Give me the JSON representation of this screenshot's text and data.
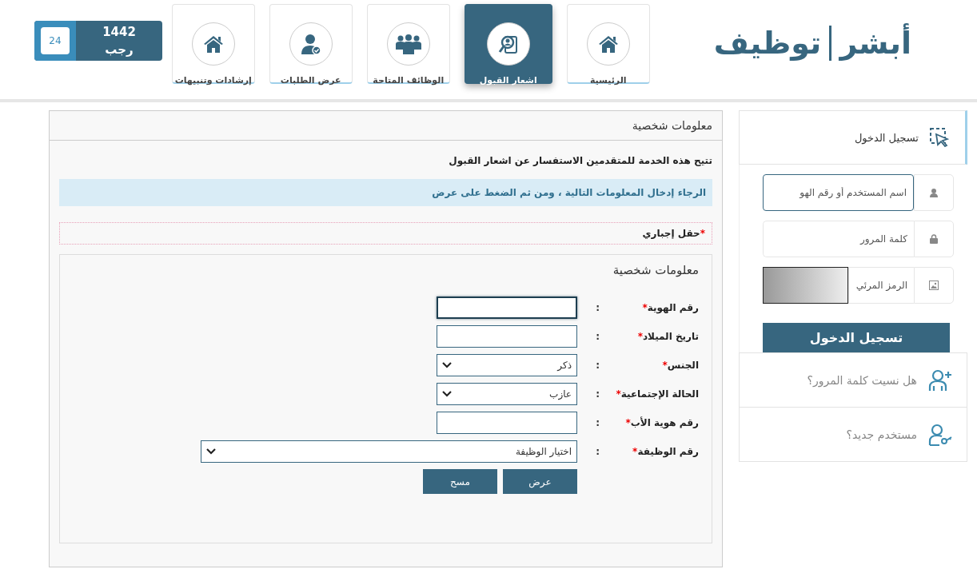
{
  "logo": {
    "word_1": "أبشر",
    "word_2": "توظيف"
  },
  "nav_tabs": [
    {
      "label": "الرئيسية",
      "kind": "home",
      "selected": false
    },
    {
      "label": "اشعار القبول",
      "kind": "acceptance",
      "selected": true
    },
    {
      "label": "الوظائف المتاحة",
      "kind": "jobs",
      "selected": false
    },
    {
      "label": "عرض الطلبات",
      "kind": "requests",
      "selected": false
    },
    {
      "label": "إرشادات وتنبيهات",
      "kind": "guidance",
      "selected": false
    }
  ],
  "date_badge": {
    "year": "1442",
    "month": "رجب",
    "day": "24"
  },
  "sidebar": {
    "login_title": "تسجيل الدخول",
    "username": {
      "placeholder": "اسم المستخدم أو رقم الهو",
      "focused": true
    },
    "password": {
      "placeholder": "كلمة المرور"
    },
    "captcha": {
      "placeholder": "الرمز المرئي"
    },
    "login_button": "تسجيل الدخول",
    "links": [
      {
        "label": "هل نسيت كلمة المرور؟",
        "kind": "forgot"
      },
      {
        "label": "مستخدم جديد؟",
        "kind": "new_user"
      }
    ]
  },
  "panel": {
    "title": "معلومات شخصية",
    "intro": "تتيح هذه الخدمة للمتقدمين الاستفسار عن اشعار القبول",
    "alert": "الرجاء إدخال المعلومات التالية ، ومن ثم الضغط على عرض",
    "required_mark": "*",
    "required_note": "حقل إجباري",
    "fieldset_title": "معلومات شخصية",
    "fields": [
      {
        "label": "رقم الهوية",
        "mark": "*",
        "colon": ":",
        "kind": "text",
        "focused": true
      },
      {
        "label": "تاريخ الميلاد",
        "mark": "*",
        "colon": ":",
        "kind": "text",
        "focused": false
      },
      {
        "label": "الجنس",
        "mark": "*",
        "colon": ":",
        "kind": "select",
        "value": "ذكر"
      },
      {
        "label": "الحالة الإجتماعية",
        "mark": "*",
        "colon": ":",
        "kind": "select",
        "value": "عازب"
      },
      {
        "label": "رقم هوية الأب",
        "mark": "*",
        "colon": ":",
        "kind": "text",
        "focused": false
      },
      {
        "label": "رقم الوظيفة",
        "mark": "*",
        "colon": ":",
        "kind": "wide_select",
        "value": "اختيار الوظيفة"
      }
    ],
    "buttons": [
      "عرض",
      "مسح"
    ]
  }
}
